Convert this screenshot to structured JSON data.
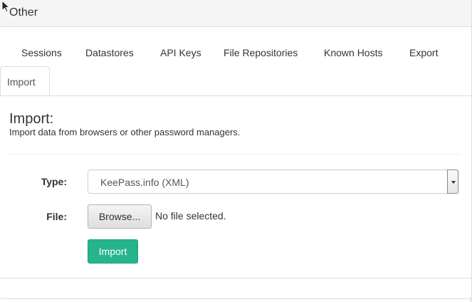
{
  "panel": {
    "title": "Other"
  },
  "tabs": [
    {
      "label": "Sessions"
    },
    {
      "label": "Datastores"
    },
    {
      "label": "API Keys"
    },
    {
      "label": "File Repositories"
    },
    {
      "label": "Known Hosts"
    },
    {
      "label": "Export"
    },
    {
      "label": "Import",
      "active": true
    }
  ],
  "section": {
    "title": "Import:",
    "description": "Import data from browsers or other password managers."
  },
  "form": {
    "type_label": "Type:",
    "type_value": "KeePass.info (XML)",
    "file_label": "File:",
    "browse_label": "Browse...",
    "file_status": "No file selected.",
    "submit_label": "Import"
  },
  "colors": {
    "primary_button": "#26b48c",
    "heading_bg": "#f5f5f5",
    "border": "#dddddd"
  },
  "icons": [
    "mouse-cursor-icon",
    "select-dropdown-icon"
  ]
}
